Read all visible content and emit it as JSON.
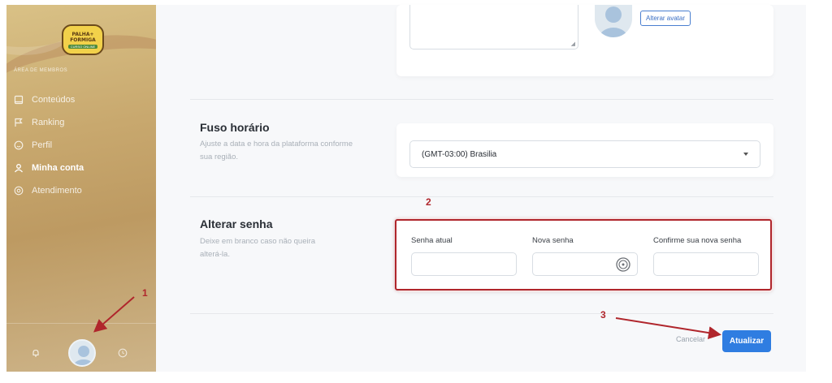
{
  "sidebar": {
    "logo": {
      "line1": "PALHA+",
      "line2": "FORMIGA",
      "line3": "CURSO ONLINE"
    },
    "section_label": "ÁREA DE MEMBROS",
    "items": [
      {
        "label": "Conteúdos",
        "icon": "book-icon",
        "active": false
      },
      {
        "label": "Ranking",
        "icon": "flag-icon",
        "active": false
      },
      {
        "label": "Perfil",
        "icon": "smile-icon",
        "active": false
      },
      {
        "label": "Minha conta",
        "icon": "user-icon",
        "active": true
      },
      {
        "label": "Atendimento",
        "icon": "at-icon",
        "active": false
      }
    ],
    "bottom_icons": [
      "bell-icon",
      "avatar",
      "clock-icon"
    ]
  },
  "profile": {
    "avatar_button": "Alterar avatar"
  },
  "timezone": {
    "title": "Fuso horário",
    "description": "Ajuste a data e hora da plataforma conforme sua região.",
    "selected": "(GMT-03:00) Brasilia"
  },
  "password": {
    "title": "Alterar senha",
    "description": "Deixe em branco caso não queira alterá-la.",
    "fields": {
      "current": {
        "label": "Senha atual",
        "value": ""
      },
      "new": {
        "label": "Nova senha",
        "value": ""
      },
      "confirm": {
        "label": "Confirme sua nova senha",
        "value": ""
      }
    }
  },
  "actions": {
    "cancel": "Cancelar",
    "update": "Atualizar"
  },
  "annotations": {
    "n1": "1",
    "n2": "2",
    "n3": "3",
    "color": "#b0262c"
  },
  "colors": {
    "primary": "#2f7de1",
    "sidebar": "#c8a86e"
  }
}
